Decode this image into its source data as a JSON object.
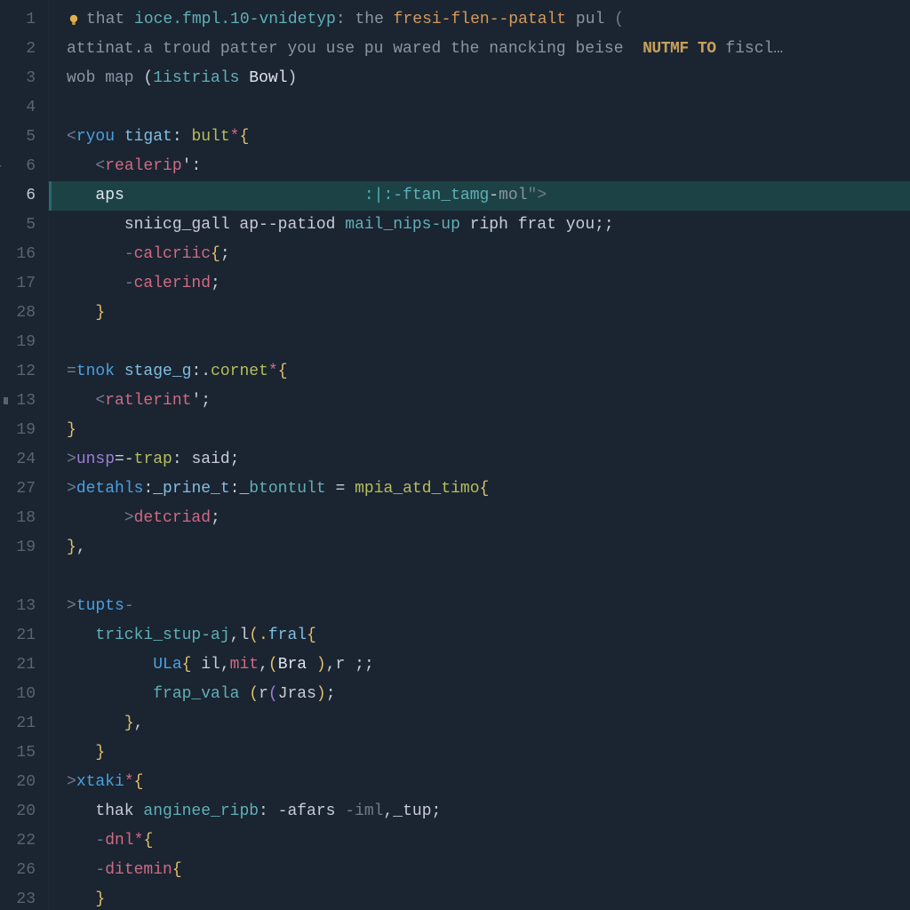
{
  "colors": {
    "background": "#1b2431",
    "gutter_text": "#5a6372",
    "active_gutter": "#c0c8d4",
    "highlight_bg": "#1d4246",
    "default": "#c7cdd8",
    "comment": "#8a94a4",
    "comment_emphasis": "#d49a5a",
    "keyword_blue": "#4aa0e0",
    "keyword_purple": "#9b7fd4",
    "tag_pink": "#d06a84",
    "attr_teal": "#5fb0b7",
    "func_cyan": "#7fbfe0",
    "string_olive": "#b5be5c",
    "number_orange": "#d49a5a",
    "badge": "#c7a05a"
  },
  "active_line_index": 6,
  "gutter": [
    {
      "n": "1"
    },
    {
      "n": "2"
    },
    {
      "n": "3"
    },
    {
      "n": "4"
    },
    {
      "n": "5"
    },
    {
      "n": "6",
      "caret": true
    },
    {
      "n": "6",
      "active": true
    },
    {
      "n": "5"
    },
    {
      "n": "16"
    },
    {
      "n": "17"
    },
    {
      "n": "28"
    },
    {
      "n": "19"
    },
    {
      "n": "12"
    },
    {
      "n": "13",
      "mark": true
    },
    {
      "n": "19"
    },
    {
      "n": "24"
    },
    {
      "n": "27"
    },
    {
      "n": "18"
    },
    {
      "n": "19"
    },
    {
      "n": ""
    },
    {
      "n": "13"
    },
    {
      "n": "21"
    },
    {
      "n": "21"
    },
    {
      "n": "10"
    },
    {
      "n": "21"
    },
    {
      "n": "15"
    },
    {
      "n": "20"
    },
    {
      "n": "20"
    },
    {
      "n": "22"
    },
    {
      "n": "26"
    },
    {
      "n": "23"
    }
  ],
  "lines": [
    {
      "indent": 0,
      "bulb": true,
      "tokens": [
        {
          "t": "that ",
          "c": "c-comment"
        },
        {
          "t": "ioce.fmpl.10-vnidetyp",
          "c": "c-attr"
        },
        {
          "t": ": the ",
          "c": "c-comment"
        },
        {
          "t": "fresi-flen--patalt",
          "c": "c-comment-em"
        },
        {
          "t": " pul ",
          "c": "c-comment"
        },
        {
          "t": "(",
          "c": "c-dim"
        }
      ]
    },
    {
      "indent": 0,
      "tokens": [
        {
          "t": "attinat.a troud patter you use pu wared the nancking beise  ",
          "c": "c-comment"
        },
        {
          "t": "NUTMF TO",
          "c": "c-badge"
        },
        {
          "t": " fiscl…",
          "c": "c-comment"
        }
      ]
    },
    {
      "indent": 0,
      "tokens": [
        {
          "t": "wob map ",
          "c": "c-comment"
        },
        {
          "t": "(",
          "c": "c-punct"
        },
        {
          "t": "1istrials ",
          "c": "c-attr"
        },
        {
          "t": "Bowl",
          "c": "c-white"
        },
        {
          "t": ")",
          "c": "c-punct"
        }
      ]
    },
    {
      "indent": 0,
      "tokens": [
        {
          "t": "",
          "c": "c-default"
        }
      ]
    },
    {
      "indent": 0,
      "tokens": [
        {
          "t": "<",
          "c": "c-dim"
        },
        {
          "t": "ryou ",
          "c": "c-keyword"
        },
        {
          "t": "tigat",
          "c": "c-func"
        },
        {
          "t": ": ",
          "c": "c-punct"
        },
        {
          "t": "bult",
          "c": "c-string"
        },
        {
          "t": "*",
          "c": "c-tag"
        },
        {
          "t": "{",
          "c": "c-paren-y"
        }
      ]
    },
    {
      "indent": 1,
      "tokens": [
        {
          "t": "<",
          "c": "c-dim"
        },
        {
          "t": "realerip",
          "c": "c-tag"
        },
        {
          "t": "':",
          "c": "c-punct"
        }
      ]
    },
    {
      "indent": 1,
      "highlight": true,
      "tokens": [
        {
          "t": "aps",
          "c": "c-white"
        },
        {
          "t": "                         ",
          "c": "c-default"
        },
        {
          "t": ":|:-",
          "c": "c-teal"
        },
        {
          "t": "ftan_tamg",
          "c": "c-attr"
        },
        {
          "t": "-",
          "c": "c-default"
        },
        {
          "t": "mol",
          "c": "c-comment"
        },
        {
          "t": "\">",
          "c": "c-dim"
        }
      ]
    },
    {
      "indent": 2,
      "tokens": [
        {
          "t": "sniicg_gall ap--patiod ",
          "c": "c-default"
        },
        {
          "t": "mail_nips-up",
          "c": "c-attr"
        },
        {
          "t": " riph frat you;",
          "c": "c-default"
        },
        {
          "t": ";",
          "c": "c-punct"
        }
      ]
    },
    {
      "indent": 2,
      "tokens": [
        {
          "t": "-",
          "c": "c-dim"
        },
        {
          "t": "calcriic",
          "c": "c-tag"
        },
        {
          "t": "{",
          "c": "c-paren-y"
        },
        {
          "t": ";",
          "c": "c-punct"
        }
      ]
    },
    {
      "indent": 2,
      "tokens": [
        {
          "t": "-",
          "c": "c-dim"
        },
        {
          "t": "calerind",
          "c": "c-tag"
        },
        {
          "t": ";",
          "c": "c-punct"
        }
      ]
    },
    {
      "indent": 1,
      "tokens": [
        {
          "t": "}",
          "c": "c-paren-y"
        }
      ]
    },
    {
      "indent": 0,
      "tokens": [
        {
          "t": "",
          "c": "c-default"
        }
      ]
    },
    {
      "indent": 0,
      "tokens": [
        {
          "t": "=",
          "c": "c-dim"
        },
        {
          "t": "tnok ",
          "c": "c-keyword"
        },
        {
          "t": "stage_g",
          "c": "c-func"
        },
        {
          "t": ":.",
          "c": "c-punct"
        },
        {
          "t": "cornet",
          "c": "c-string"
        },
        {
          "t": "*",
          "c": "c-tag"
        },
        {
          "t": "{",
          "c": "c-paren-y"
        }
      ]
    },
    {
      "indent": 1,
      "tokens": [
        {
          "t": "<",
          "c": "c-dim"
        },
        {
          "t": "ratlerint",
          "c": "c-tag"
        },
        {
          "t": "';",
          "c": "c-punct"
        }
      ]
    },
    {
      "indent": 0,
      "tokens": [
        {
          "t": "}",
          "c": "c-paren-y"
        }
      ]
    },
    {
      "indent": 0,
      "tokens": [
        {
          "t": ">",
          "c": "c-dim"
        },
        {
          "t": "unsp",
          "c": "c-keyword2"
        },
        {
          "t": "=-",
          "c": "c-punct"
        },
        {
          "t": "trap",
          "c": "c-string"
        },
        {
          "t": ": said;",
          "c": "c-default"
        }
      ]
    },
    {
      "indent": 0,
      "tokens": [
        {
          "t": ">",
          "c": "c-dim"
        },
        {
          "t": "detahls",
          "c": "c-keyword"
        },
        {
          "t": ":_",
          "c": "c-punct"
        },
        {
          "t": "prine_t",
          "c": "c-func"
        },
        {
          "t": ":_",
          "c": "c-punct"
        },
        {
          "t": "btontult",
          "c": "c-attr"
        },
        {
          "t": " = ",
          "c": "c-punct"
        },
        {
          "t": "mpia_atd_timo",
          "c": "c-string"
        },
        {
          "t": "{",
          "c": "c-paren-y"
        }
      ]
    },
    {
      "indent": 2,
      "tokens": [
        {
          "t": ">",
          "c": "c-dim"
        },
        {
          "t": "detcriad",
          "c": "c-tag"
        },
        {
          "t": ";",
          "c": "c-punct"
        }
      ]
    },
    {
      "indent": 0,
      "tokens": [
        {
          "t": "}",
          "c": "c-paren-y"
        },
        {
          "t": ",",
          "c": "c-punct"
        }
      ]
    },
    {
      "indent": 0,
      "tokens": [
        {
          "t": "",
          "c": "c-default"
        }
      ]
    },
    {
      "indent": 0,
      "tokens": [
        {
          "t": ">",
          "c": "c-dim"
        },
        {
          "t": "tupts",
          "c": "c-keyword"
        },
        {
          "t": "-",
          "c": "c-dim"
        }
      ]
    },
    {
      "indent": 1,
      "tokens": [
        {
          "t": "tricki_stup-aj",
          "c": "c-attr"
        },
        {
          "t": ",l",
          "c": "c-punct"
        },
        {
          "t": "(.",
          "c": "c-paren-y"
        },
        {
          "t": "fral",
          "c": "c-func"
        },
        {
          "t": "{",
          "c": "c-paren-y"
        }
      ]
    },
    {
      "indent": 3,
      "tokens": [
        {
          "t": "ULa",
          "c": "c-keyword"
        },
        {
          "t": "{ ",
          "c": "c-paren-y"
        },
        {
          "t": "il",
          "c": "c-default"
        },
        {
          "t": ",",
          "c": "c-punct"
        },
        {
          "t": "mit",
          "c": "c-tag"
        },
        {
          "t": ",",
          "c": "c-punct"
        },
        {
          "t": "(",
          "c": "c-paren-y"
        },
        {
          "t": "Bra ",
          "c": "c-white"
        },
        {
          "t": ")",
          "c": "c-paren-y"
        },
        {
          "t": ",r ;",
          "c": "c-default"
        },
        {
          "t": ";",
          "c": "c-punct"
        }
      ]
    },
    {
      "indent": 3,
      "tokens": [
        {
          "t": "frap_vala ",
          "c": "c-attr"
        },
        {
          "t": "(",
          "c": "c-paren-y"
        },
        {
          "t": "r",
          "c": "c-default"
        },
        {
          "t": "(",
          "c": "c-keyword2"
        },
        {
          "t": "Jras",
          "c": "c-default"
        },
        {
          "t": ")",
          "c": "c-paren-y"
        },
        {
          "t": ";",
          "c": "c-punct"
        }
      ]
    },
    {
      "indent": 2,
      "tokens": [
        {
          "t": "}",
          "c": "c-paren-y"
        },
        {
          "t": ",",
          "c": "c-punct"
        }
      ]
    },
    {
      "indent": 1,
      "tokens": [
        {
          "t": "}",
          "c": "c-paren-y"
        }
      ]
    },
    {
      "indent": 0,
      "tokens": [
        {
          "t": ">",
          "c": "c-dim"
        },
        {
          "t": "xtaki",
          "c": "c-keyword"
        },
        {
          "t": "*",
          "c": "c-tag"
        },
        {
          "t": "{",
          "c": "c-paren-y"
        }
      ]
    },
    {
      "indent": 1,
      "tokens": [
        {
          "t": "thak ",
          "c": "c-default"
        },
        {
          "t": "anginee_ripb",
          "c": "c-attr"
        },
        {
          "t": ": -afars ",
          "c": "c-default"
        },
        {
          "t": "-iml",
          "c": "c-dim"
        },
        {
          "t": ",_tup;",
          "c": "c-default"
        }
      ]
    },
    {
      "indent": 1,
      "tokens": [
        {
          "t": "-",
          "c": "c-dim"
        },
        {
          "t": "dnl",
          "c": "c-tag"
        },
        {
          "t": "*",
          "c": "c-tag"
        },
        {
          "t": "{",
          "c": "c-paren-y"
        }
      ]
    },
    {
      "indent": 1,
      "tokens": [
        {
          "t": "-",
          "c": "c-dim"
        },
        {
          "t": "ditemin",
          "c": "c-tag"
        },
        {
          "t": "{",
          "c": "c-paren-y"
        }
      ]
    },
    {
      "indent": 1,
      "tokens": [
        {
          "t": "}",
          "c": "c-paren-y"
        }
      ]
    }
  ]
}
